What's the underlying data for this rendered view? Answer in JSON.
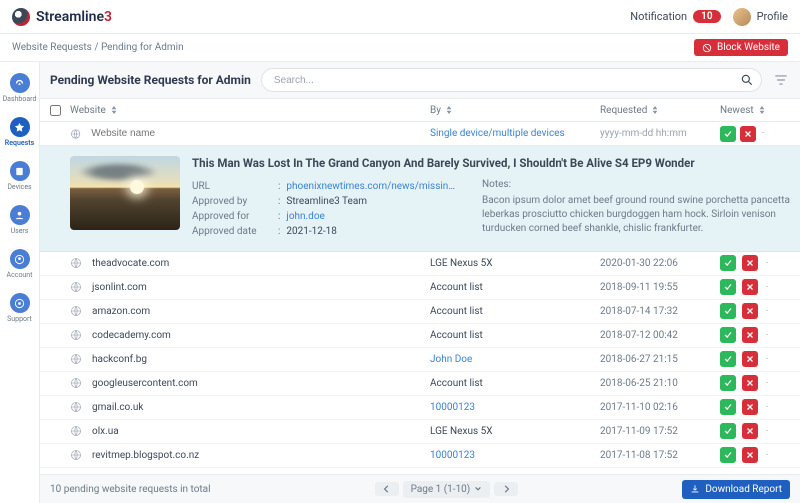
{
  "topbar": {
    "brand1": "Streamline",
    "brand2": "3",
    "notification_label": "Notification",
    "notification_count": "10",
    "profile_label": "Profile"
  },
  "breadcrumb": {
    "a": "Website Requests",
    "sep": " / ",
    "b": "Pending for Admin"
  },
  "block_button": "Block Website",
  "nav": [
    {
      "label": "Dashboard"
    },
    {
      "label": "Requests"
    },
    {
      "label": "Devices"
    },
    {
      "label": "Users"
    },
    {
      "label": "Account"
    },
    {
      "label": "Support"
    }
  ],
  "page_title": "Pending Website Requests for Admin",
  "search_placeholder": "Search...",
  "columns": {
    "website": "Website",
    "by": "By",
    "requested": "Requested",
    "newest": "Newest"
  },
  "filters": {
    "website_placeholder": "Website name",
    "by_placeholder": "Single device/multiple devices",
    "requested_placeholder": "yyyy-mm-dd hh:mm"
  },
  "detail": {
    "title": "This Man Was Lost In The Grand Canyon And Barely Survived, I Shouldn't Be Alive S4 EP9 Wonder",
    "url_k": "URL",
    "url_v": "phoenixnewtimes.com/news/missing-man-grand-can...",
    "appby_k": "Approved by",
    "appby_v": "Streamline3 Team",
    "appfor_k": "Approved for",
    "appfor_v": "john.doe",
    "date_k": "Approved date",
    "date_v": "2021-12-18",
    "notes_k": "Notes:",
    "notes_v": "Bacon ipsum dolor amet beef ground round swine porchetta pancetta leberkas prosciutto chicken burgdoggen ham hock. Sirloin venison turducken corned beef shankle, chislic frankfurter."
  },
  "rows": [
    {
      "site": "theadvocate.com",
      "by": "LGE Nexus 5X",
      "by_link": false,
      "req": "2020-01-30 22:06"
    },
    {
      "site": "jsonlint.com",
      "by": "Account list",
      "by_link": false,
      "req": "2018-09-11 19:55"
    },
    {
      "site": "amazon.com",
      "by": "Account list",
      "by_link": false,
      "req": "2018-07-14 17:32"
    },
    {
      "site": "codecademy.com",
      "by": "Account list",
      "by_link": false,
      "req": "2018-07-12 00:42"
    },
    {
      "site": "hackconf.bg",
      "by": "John Doe",
      "by_link": true,
      "req": "2018-06-27 21:15"
    },
    {
      "site": "googleusercontent.com",
      "by": "Account list",
      "by_link": false,
      "req": "2018-06-25 21:10"
    },
    {
      "site": "gmail.co.uk",
      "by": "10000123",
      "by_link": true,
      "req": "2017-11-10 02:16"
    },
    {
      "site": "olx.ua",
      "by": "LGE Nexus 5X",
      "by_link": false,
      "req": "2017-11-09 17:52"
    },
    {
      "site": "revitmep.blogspot.co.nz",
      "by": "10000123",
      "by_link": true,
      "req": "2017-11-08 17:52"
    }
  ],
  "footer": {
    "total": "10 pending website requests in total",
    "page": "Page 1 (1-10)",
    "download": "Download Report"
  }
}
